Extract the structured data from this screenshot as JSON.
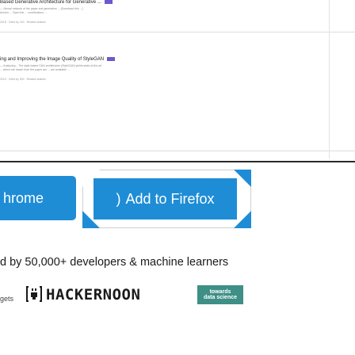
{
  "papers": [
    {
      "title": "Based Generative Architecture for Generative ...",
      "line1": "— Neural network of the paper and generative ... [Download this ...]",
      "line2": "Anchor ... Open the ... contributions ...",
      "meta": "2018 · Cited by 150 · Related articles"
    },
    {
      "title": "ing and Improving the Image Quality of StyleGAN",
      "line1": "— Analyzing... The style-based GAN architecture (StyleGAN) yields state-of-the-art",
      "line2": "... which are drawn from the paper are ... are available ...",
      "meta": "2019 · Cited by 300 · Related articles"
    }
  ],
  "buttons": {
    "chrome_label": "hrome",
    "firefox_label": "Add to Firefox"
  },
  "tagline": "d by 50,000+ developers & machine learners",
  "footer": {
    "widgets_label": "gets",
    "hackernoon": "HACKERNOON",
    "tds_line1": "towards",
    "tds_line2": "data science"
  },
  "colors": {
    "accent": "#1e8dd6",
    "badge": "#6a5acd",
    "tds": "#3e8f86"
  }
}
